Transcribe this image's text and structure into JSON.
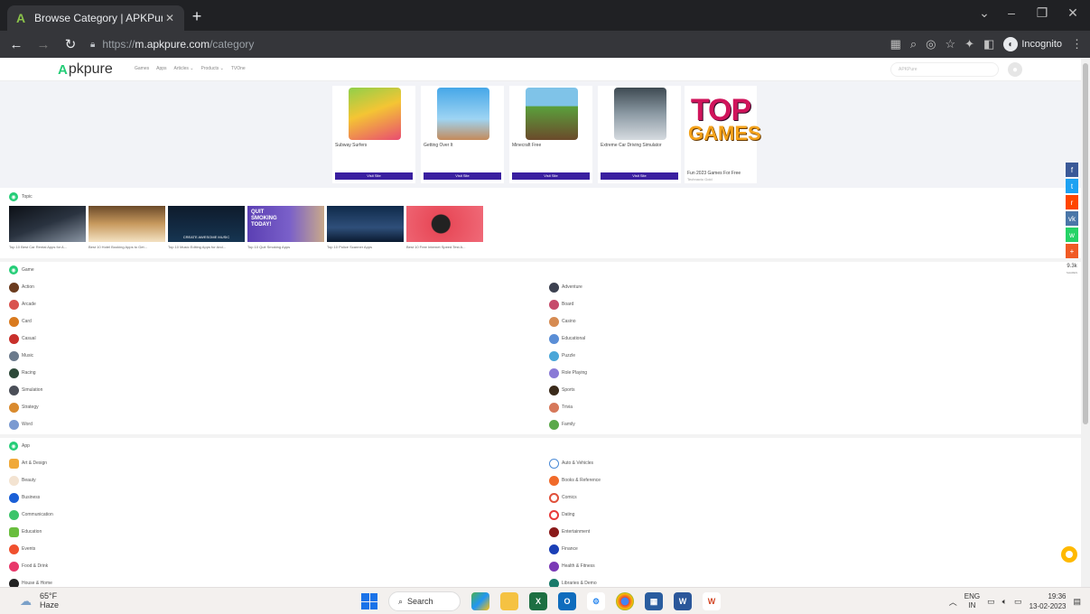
{
  "browser": {
    "tab_title": "Browse Category | APKPure.com",
    "url_scheme": "https://",
    "url_host": "m.apkpure.com",
    "url_path": "/category",
    "incognito_label": "Incognito"
  },
  "site": {
    "logo_text": "pkpure",
    "logo_letter": "A",
    "nav": [
      "Games",
      "Apps",
      "Articles ⌄",
      "Products ⌄",
      "TVOne"
    ],
    "search_placeholder": "APKPure"
  },
  "ads": {
    "cards": [
      {
        "name": "Subway Surfers",
        "button": "Visit Site"
      },
      {
        "name": "Getting Over It",
        "button": "Visit Site"
      },
      {
        "name": "Minecraft Free",
        "button": "Visit Site"
      },
      {
        "name": "Extreme Car Driving Simulator",
        "button": "Visit Site"
      }
    ],
    "top_games": {
      "line1": "TOP",
      "line2": "GAMES",
      "caption": "Fun 2023 Games For Free",
      "sub": "Technavio Gold"
    }
  },
  "topics": {
    "title": "Topic",
    "items": [
      {
        "caption": "Top 10 Best Car Rental Apps for A..."
      },
      {
        "caption": "Best 10 Hotel Booking Apps to Get..."
      },
      {
        "caption": "Top 10 Music Editing Apps for And..."
      },
      {
        "caption": "Top 10 Quit Smoking Apps"
      },
      {
        "caption": "Top 10 Police Scanner Apps"
      },
      {
        "caption": "Best 10 Free Internet Speed Test A..."
      }
    ],
    "banner_text_3": "CREATE AWESOME MUSIC",
    "banner_text_4": "QUIT SMOKING TODAY!"
  },
  "game_section": {
    "title": "Game",
    "left": [
      "Action",
      "Arcade",
      "Card",
      "Casual",
      "Music",
      "Racing",
      "Simulation",
      "Strategy",
      "Word"
    ],
    "right": [
      "Adventure",
      "Board",
      "Casino",
      "Educational",
      "Puzzle",
      "Role Playing",
      "Sports",
      "Trivia",
      "Family"
    ]
  },
  "app_section": {
    "title": "App",
    "left": [
      "Art & Design",
      "Beauty",
      "Business",
      "Communication",
      "Education",
      "Events",
      "Food & Drink",
      "House & Home"
    ],
    "right": [
      "Auto & Vehicles",
      "Books & Reference",
      "Comics",
      "Dating",
      "Entertainment",
      "Finance",
      "Health & Fitness",
      "Libraries & Demo"
    ]
  },
  "share": {
    "count": "9.3k",
    "label": "SHARES",
    "buttons": [
      "f",
      "t",
      "r",
      "vk",
      "w",
      "+"
    ]
  },
  "taskbar": {
    "temp": "65°F",
    "condition": "Haze",
    "search_label": "Search",
    "lang1": "ENG",
    "lang2": "IN",
    "time": "19:36",
    "date": "13-02-2023"
  },
  "colors": {
    "brand_green": "#24cd77",
    "ad_button": "#3a1fa0",
    "facebook": "#3b5998",
    "twitter": "#1da1f2",
    "reddit": "#ff4500",
    "vk": "#4a76a8",
    "whatsapp": "#25d366",
    "more": "#f05a24"
  }
}
